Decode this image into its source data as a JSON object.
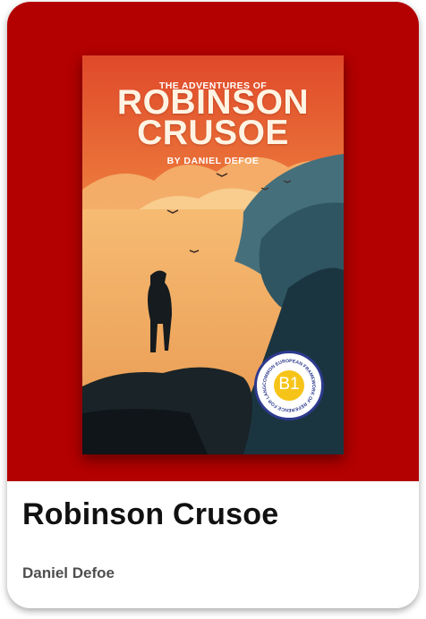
{
  "book": {
    "title": "Robinson Crusoe",
    "author": "Daniel Defoe"
  },
  "cover": {
    "eyebrow": "THE ADVENTURES OF",
    "title_line1": "ROBINSON",
    "title_line2": "CRUSOE",
    "author_line": "BY DANIEL DEFOE"
  },
  "level_badge": {
    "level": "B1",
    "ring_text": "COMMON EUROPEAN FRAMEWORK OF REFERENCE FOR LANGUAGES"
  },
  "colors": {
    "card_header_background": "#b30000",
    "card_background": "#ffffff",
    "badge_ring": "#2d3a8e",
    "badge_center": "#f6c419"
  }
}
